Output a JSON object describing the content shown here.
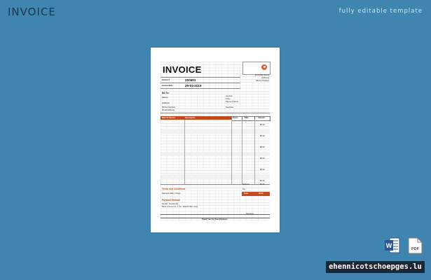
{
  "header": {
    "title": "INVOICE",
    "subtitle": "fully editable template"
  },
  "invoice": {
    "title": "INVOICE",
    "company": [
      "[Company Name]",
      "[Address]",
      "[Phone Number]"
    ],
    "invoice_no_label": "Invoice #",
    "invoice_no": "250903",
    "invoice_date_label": "Invoice Date",
    "invoice_date": "25-04-2019",
    "bill_to": "Bill To:",
    "bill_fields": [
      "[Name]",
      "[Address]",
      "[Phone Number]",
      "[Email Address]"
    ],
    "right_fields": [
      "Contract",
      "Order",
      "Payment Terms",
      "Due Date"
    ],
    "table_headers": {
      "date": "Date Of Service",
      "desc": "Description",
      "hours": "Hours",
      "rate": "Rate",
      "amount": "Amount"
    },
    "amounts": [
      "$0.00",
      "$0.00",
      "$0.00",
      "$0.00",
      "$0.00",
      "$0.00",
      "$0.00"
    ],
    "subtotal_label": "Subtotal",
    "subtotal": "$0.00",
    "tax_label": "Tax",
    "total_label": "Total",
    "total": "$0.00",
    "terms_title": "Terms and Conditions",
    "terms_text": "Payment within 7 Days",
    "payment_title": "Payment Method",
    "payment_lines": [
      "Sender: [Sender ID]",
      "Bank: Account no. 0, No., Branch, BIC, Corp."
    ],
    "signature": "Signature",
    "thanks": "Thank You For Your Business"
  },
  "badges": {
    "word": "W",
    "pdf": "PDF"
  },
  "footer": {
    "brand": "ehennicotschoepges.lu"
  },
  "colors": {
    "background": "#3f85b0",
    "accent": "#c34a1e",
    "brand_bg": "#1d2633"
  }
}
